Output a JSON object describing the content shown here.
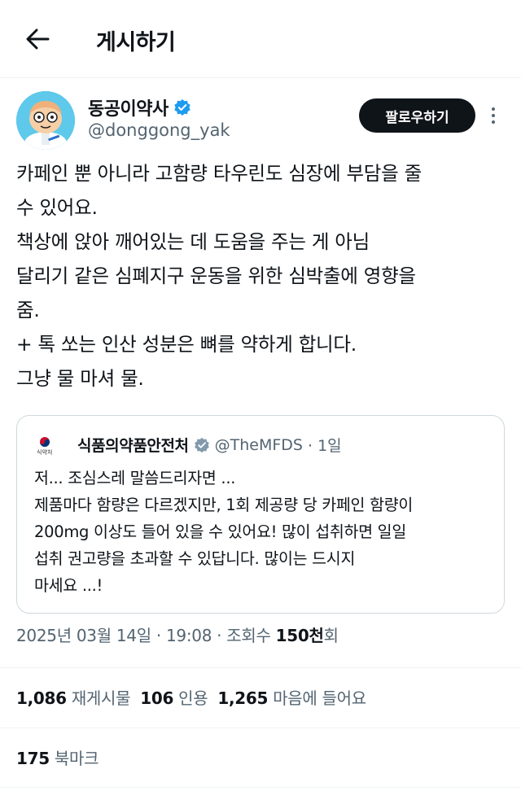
{
  "header": {
    "title": "게시하기"
  },
  "author": {
    "name": "동공이약사",
    "handle": "@donggong_yak",
    "follow_label": "팔로우하기"
  },
  "tweet": {
    "lines": [
      "카페인 뿐 아니라 고함량 타우린도 심장에 부담을 줄",
      "수 있어요.",
      "책상에 앉아 깨어있는 데 도움을 주는 게 아님",
      "달리기 같은 심폐지구 운동을 위한 심박출에 영향을",
      "줌.",
      "+ 톡 쏘는 인산 성분은 뼈를 약하게 합니다.",
      "그냥 물 마셔 물."
    ]
  },
  "quote": {
    "org_logo_text": "식약처",
    "name": "식품의약품안전처",
    "handle": "@TheMFDS",
    "time": "· 1일",
    "lines": [
      "저... 조심스레 말씀드리자면 ...",
      "제품마다 함량은 다르겠지만, 1회 제공량 당 카페인 함량이",
      "200mg 이상도 들어 있을 수 있어요! 많이 섭취하면 일일",
      "섭취 권고량을 초과할 수 있답니다. 많이는 드시지",
      "마세요 ...!"
    ]
  },
  "meta": {
    "datetime": "2025년 03월 14일 · 19:08 · 조회수 ",
    "views_value": "150천",
    "views_suffix": "회"
  },
  "stats": {
    "retweets_value": "1,086",
    "retweets_label": "재게시물",
    "quotes_value": "106",
    "quotes_label": "인용",
    "likes_value": "1,265",
    "likes_label": "마음에 들어요",
    "bookmarks_value": "175",
    "bookmarks_label": "북마크"
  },
  "colors": {
    "text": "#0f1419",
    "secondary": "#536471",
    "verified": "#1d9bf0",
    "border": "#cfd9de",
    "divider": "#eff3f4"
  }
}
